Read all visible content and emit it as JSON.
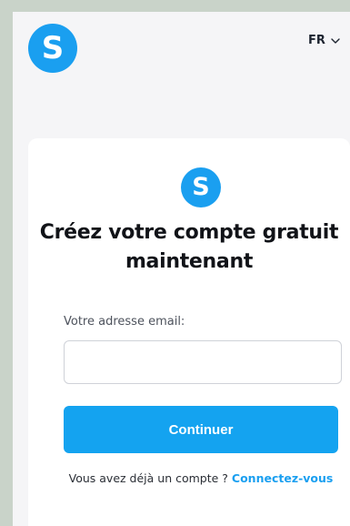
{
  "header": {
    "logo_letter": "S",
    "language": "FR",
    "icons": {
      "logo": "brand-s-logo",
      "lang_toggle": "chevron-down-icon"
    }
  },
  "card": {
    "logo_letter": "S",
    "title": "Créez votre compte gratuit maintenant",
    "email_label": "Votre adresse email:",
    "email_value": "",
    "email_placeholder": "",
    "continue_label": "Continuer",
    "signin_prefix": "Vous avez déjà un compte ?",
    "signin_link": "Connectez-vous"
  },
  "colors": {
    "accent": "#1a9ff0",
    "page_background": "#f5f5f7",
    "outer_background": "#c9d3c9",
    "card_background": "#ffffff"
  }
}
